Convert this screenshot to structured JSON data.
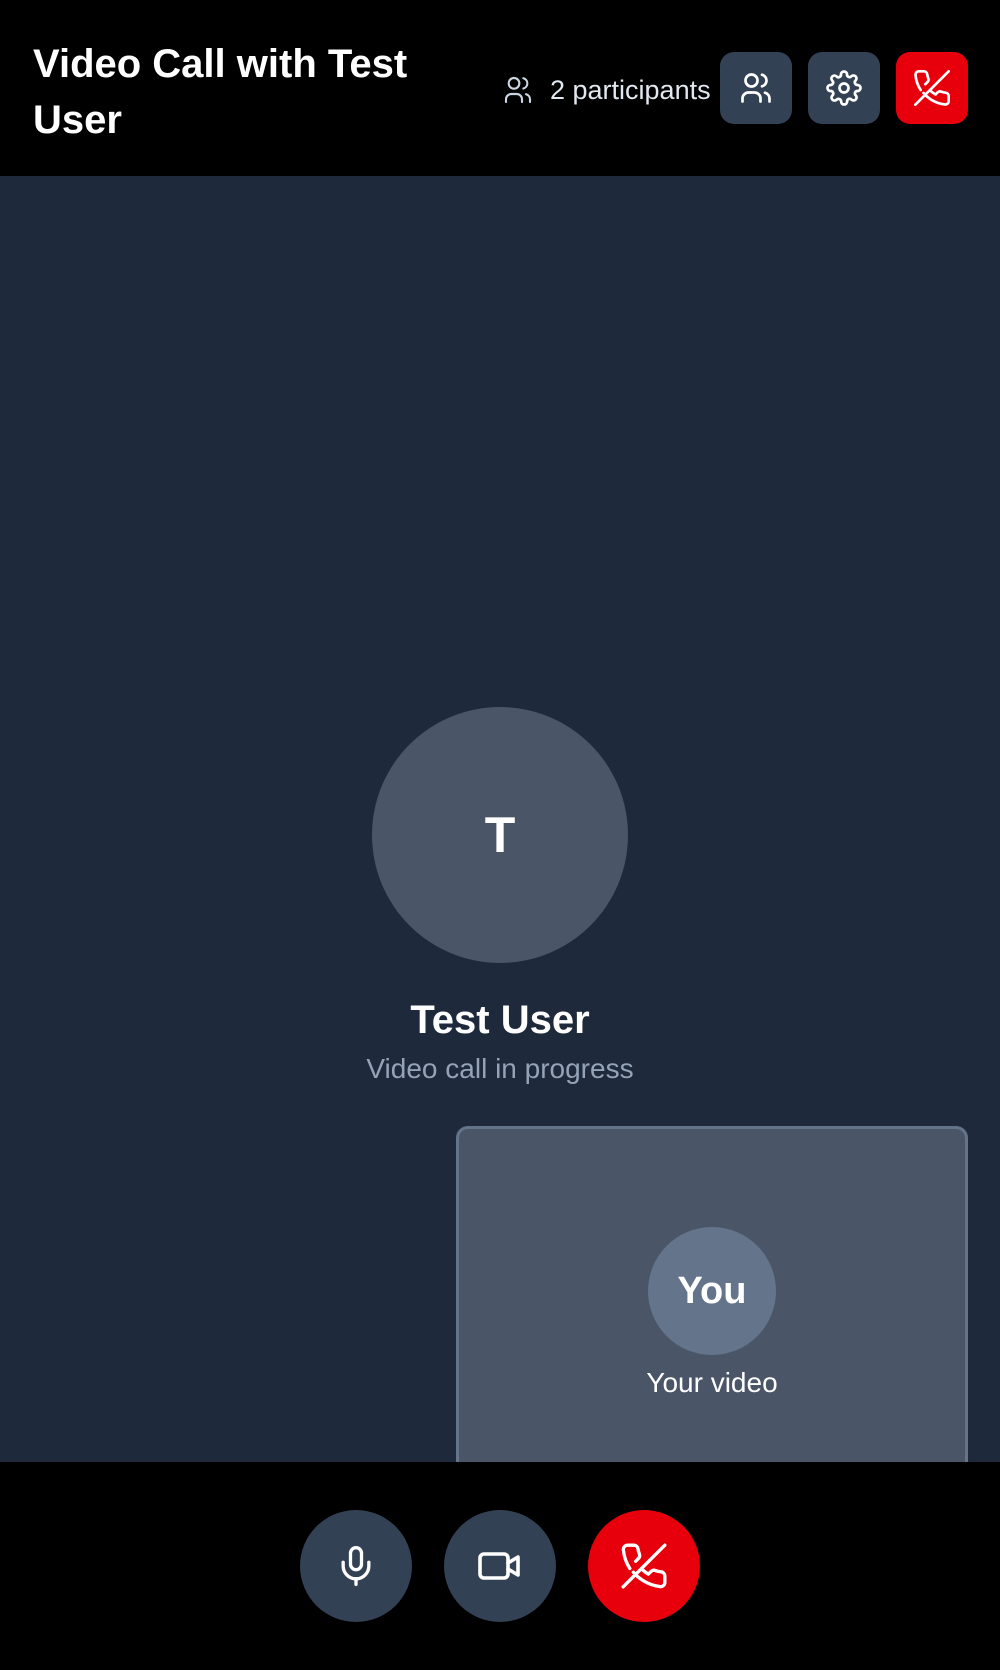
{
  "header": {
    "title": "Video Call with Test User",
    "participants_label": "2 participants",
    "participants_icon": "users-icon",
    "buttons": {
      "participants": {
        "icon": "users-icon"
      },
      "settings": {
        "icon": "gear-icon"
      },
      "end_call": {
        "icon": "phone-off-icon"
      }
    }
  },
  "remote": {
    "initial": "T",
    "name": "Test User",
    "status": "Video call in progress"
  },
  "self_view": {
    "avatar_label": "You",
    "label": "Your video"
  },
  "controls": {
    "mic": {
      "icon": "microphone-icon"
    },
    "camera": {
      "icon": "video-camera-icon"
    },
    "end_call": {
      "icon": "phone-off-icon"
    }
  },
  "colors": {
    "background": "#1e293b",
    "bar": "#000000",
    "button_gray": "#334155",
    "danger": "#e7000b",
    "avatar": "#4a5568",
    "muted_text": "#94a3b8"
  }
}
